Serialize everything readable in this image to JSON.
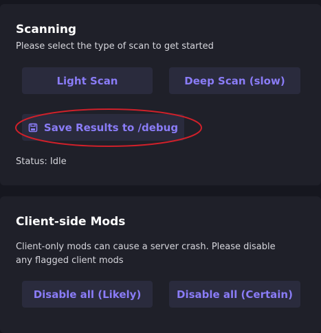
{
  "scanning": {
    "title": "Scanning",
    "description": "Please select the type of scan to get started",
    "light_scan_label": "Light Scan",
    "deep_scan_label": "Deep Scan (slow)",
    "save_results_label": "Save Results to /debug",
    "status_text": "Status: Idle"
  },
  "mods": {
    "title": "Client-side Mods",
    "description_line1": "Client-only mods can cause a server crash. Please disable",
    "description_line2": "any flagged client mods",
    "disable_likely_label": "Disable all (Likely)",
    "disable_certain_label": "Disable all (Certain)"
  },
  "icons": {
    "save": "save-icon"
  },
  "colors": {
    "accent": "#8a7cf7",
    "highlight_ring": "#d0202a"
  }
}
